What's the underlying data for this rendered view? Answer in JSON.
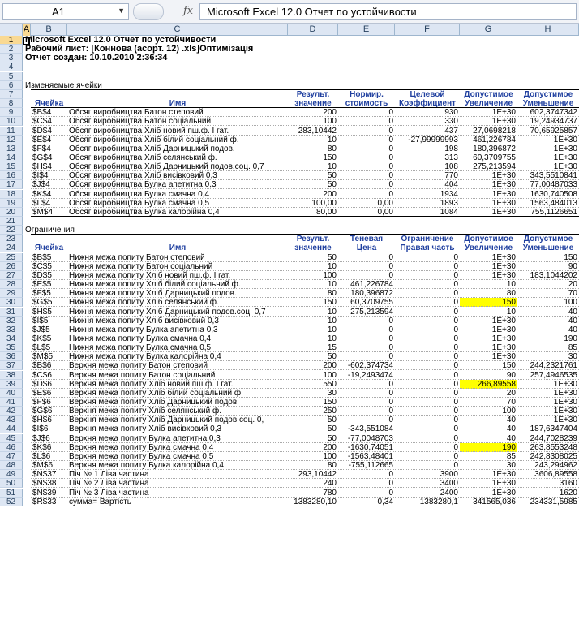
{
  "formula_bar": {
    "cell_ref": "A1",
    "fx": "fx",
    "formula": "Microsoft Excel 12.0 Отчет по устойчивости"
  },
  "columns": [
    "A",
    "B",
    "C",
    "D",
    "E",
    "F",
    "G",
    "H"
  ],
  "title_rows": {
    "r1": "Microsoft Excel 12.0 Отчет по устойчивости",
    "r2": "Рабочий лист: [Коннова (асорт. 12) .xls]Оптимізація",
    "r3": "Отчет создан: 10.10.2010 2:36:34"
  },
  "section1": {
    "title": "Изменяемые ячейки",
    "headers": {
      "cell": "Ячейка",
      "name": "Имя",
      "result": [
        "Результ.",
        "значение"
      ],
      "norm": [
        "Нормир.",
        "стоимость"
      ],
      "target": [
        "Целевой",
        "Коэффициент"
      ],
      "inc": [
        "Допустимое",
        "Увеличение"
      ],
      "dec": [
        "Допустимое",
        "Уменьшение"
      ]
    },
    "rows": [
      {
        "n": "9",
        "cell": "$B$4",
        "name": "Обсяг виробництва  Батон степовий",
        "d": "200",
        "e": "0",
        "f": "930",
        "g": "1E+30",
        "h": "602,3747342"
      },
      {
        "n": "10",
        "cell": "$C$4",
        "name": "Обсяг виробництва Батон соціальний",
        "d": "100",
        "e": "0",
        "f": "330",
        "g": "1E+30",
        "h": "19,24934737"
      },
      {
        "n": "11",
        "cell": "$D$4",
        "name": "Обсяг виробництва Хліб новий пш.ф. І гат.",
        "d": "283,10442",
        "e": "0",
        "f": "437",
        "g": "27,0698218",
        "h": "70,65925857"
      },
      {
        "n": "12",
        "cell": "$E$4",
        "name": "Обсяг виробництва Хліб білий соціальний ф.",
        "d": "10",
        "e": "0",
        "f": "-27,99999993",
        "g": "461,226784",
        "h": "1E+30"
      },
      {
        "n": "13",
        "cell": "$F$4",
        "name": "Обсяг виробництва Хліб Дарницький подов.",
        "d": "80",
        "e": "0",
        "f": "198",
        "g": "180,396872",
        "h": "1E+30"
      },
      {
        "n": "14",
        "cell": "$G$4",
        "name": "Обсяг виробництва Хліб селянський ф.",
        "d": "150",
        "e": "0",
        "f": "313",
        "g": "60,3709755",
        "h": "1E+30"
      },
      {
        "n": "15",
        "cell": "$H$4",
        "name": "Обсяг виробництва Хліб Дарницький подов.соц. 0,7",
        "d": "10",
        "e": "0",
        "f": "108",
        "g": "275,213594",
        "h": "1E+30"
      },
      {
        "n": "16",
        "cell": "$I$4",
        "name": "Обсяг виробництва Хліб висівковий 0,3",
        "d": "50",
        "e": "0",
        "f": "770",
        "g": "1E+30",
        "h": "343,5510841"
      },
      {
        "n": "17",
        "cell": "$J$4",
        "name": "Обсяг виробництва Булка апетитна 0,3",
        "d": "50",
        "e": "0",
        "f": "404",
        "g": "1E+30",
        "h": "77,00487033"
      },
      {
        "n": "18",
        "cell": "$K$4",
        "name": "Обсяг виробництва Булка смачна 0,4",
        "d": "200",
        "e": "0",
        "f": "1934",
        "g": "1E+30",
        "h": "1630,740508"
      },
      {
        "n": "19",
        "cell": "$L$4",
        "name": "Обсяг виробництва Булка смачна 0,5",
        "d": "100,00",
        "e": "0,00",
        "f": "1893",
        "g": "1E+30",
        "h": "1563,484013"
      },
      {
        "n": "20",
        "cell": "$M$4",
        "name": "Обсяг виробництва Булка калорійна 0,4",
        "d": "80,00",
        "e": "0,00",
        "f": "1084",
        "g": "1E+30",
        "h": "755,1126651"
      }
    ]
  },
  "section2": {
    "title": "Ограничения",
    "headers": {
      "cell": "Ячейка",
      "name": "Имя",
      "result": [
        "Результ.",
        "значение"
      ],
      "shadow": [
        "Теневая",
        "Цена"
      ],
      "rhs": [
        "Ограничение",
        "Правая часть"
      ],
      "inc": [
        "Допустимое",
        "Увеличение"
      ],
      "dec": [
        "Допустимое",
        "Уменьшение"
      ]
    },
    "rows": [
      {
        "n": "25",
        "cell": "$B$5",
        "name": "Нижня межа попиту  Батон степовий",
        "d": "50",
        "e": "0",
        "f": "0",
        "g": "1E+30",
        "h": "150"
      },
      {
        "n": "26",
        "cell": "$C$5",
        "name": "Нижня межа попиту Батон соціальний",
        "d": "10",
        "e": "0",
        "f": "0",
        "g": "1E+30",
        "h": "90"
      },
      {
        "n": "27",
        "cell": "$D$5",
        "name": "Нижня межа попиту Хліб новий пш.ф. І гат.",
        "d": "100",
        "e": "0",
        "f": "0",
        "g": "1E+30",
        "h": "183,1044202"
      },
      {
        "n": "28",
        "cell": "$E$5",
        "name": "Нижня межа попиту Хліб білий соціальний ф.",
        "d": "10",
        "e": "461,226784",
        "f": "0",
        "g": "10",
        "h": "20"
      },
      {
        "n": "29",
        "cell": "$F$5",
        "name": "Нижня межа попиту Хліб Дарницький подов.",
        "d": "80",
        "e": "180,396872",
        "f": "0",
        "g": "80",
        "h": "70"
      },
      {
        "n": "30",
        "cell": "$G$5",
        "name": "Нижня межа попиту Хліб селянський ф.",
        "d": "150",
        "e": "60,3709755",
        "f": "0",
        "g": "150",
        "h": "100",
        "hl": true
      },
      {
        "n": "31",
        "cell": "$H$5",
        "name": "Нижня межа попиту Хліб Дарницький подов.соц. 0,7",
        "d": "10",
        "e": "275,213594",
        "f": "0",
        "g": "10",
        "h": "40"
      },
      {
        "n": "32",
        "cell": "$I$5",
        "name": "Нижня межа попиту Хліб висівковий 0,3",
        "d": "10",
        "e": "0",
        "f": "0",
        "g": "1E+30",
        "h": "40"
      },
      {
        "n": "33",
        "cell": "$J$5",
        "name": "Нижня межа попиту Булка апетитна 0,3",
        "d": "10",
        "e": "0",
        "f": "0",
        "g": "1E+30",
        "h": "40"
      },
      {
        "n": "34",
        "cell": "$K$5",
        "name": "Нижня межа попиту Булка смачна 0,4",
        "d": "10",
        "e": "0",
        "f": "0",
        "g": "1E+30",
        "h": "190"
      },
      {
        "n": "35",
        "cell": "$L$5",
        "name": "Нижня межа попиту Булка смачна 0,5",
        "d": "15",
        "e": "0",
        "f": "0",
        "g": "1E+30",
        "h": "85"
      },
      {
        "n": "36",
        "cell": "$M$5",
        "name": "Нижня межа попиту Булка калорійна 0,4",
        "d": "50",
        "e": "0",
        "f": "0",
        "g": "1E+30",
        "h": "30"
      },
      {
        "n": "37",
        "cell": "$B$6",
        "name": "Верхня межа попиту  Батон степовий",
        "d": "200",
        "e": "-602,374734",
        "f": "0",
        "g": "150",
        "h": "244,2321761"
      },
      {
        "n": "38",
        "cell": "$C$6",
        "name": "Верхня межа попиту Батон соціальний",
        "d": "100",
        "e": "-19,2493474",
        "f": "0",
        "g": "90",
        "h": "257,4946535"
      },
      {
        "n": "39",
        "cell": "$D$6",
        "name": "Верхня межа попиту Хліб новий пш.ф. І гат.",
        "d": "550",
        "e": "0",
        "f": "0",
        "g": "266,89558",
        "h": "1E+30",
        "hl": true
      },
      {
        "n": "40",
        "cell": "$E$6",
        "name": "Верхня межа попиту Хліб білий соціальний ф.",
        "d": "30",
        "e": "0",
        "f": "0",
        "g": "20",
        "h": "1E+30"
      },
      {
        "n": "41",
        "cell": "$F$6",
        "name": "Верхня межа попиту Хліб Дарницький подов.",
        "d": "150",
        "e": "0",
        "f": "0",
        "g": "70",
        "h": "1E+30"
      },
      {
        "n": "42",
        "cell": "$G$6",
        "name": "Верхня межа попиту Хліб селянський ф.",
        "d": "250",
        "e": "0",
        "f": "0",
        "g": "100",
        "h": "1E+30"
      },
      {
        "n": "43",
        "cell": "$H$6",
        "name": "Верхня межа попиту Хліб Дарницький подов.соц. 0,",
        "d": "50",
        "e": "0",
        "f": "0",
        "g": "40",
        "h": "1E+30"
      },
      {
        "n": "44",
        "cell": "$I$6",
        "name": "Верхня межа попиту Хліб висівковий 0,3",
        "d": "50",
        "e": "-343,551084",
        "f": "0",
        "g": "40",
        "h": "187,6347404"
      },
      {
        "n": "45",
        "cell": "$J$6",
        "name": "Верхня межа попиту Булка апетитна 0,3",
        "d": "50",
        "e": "-77,0048703",
        "f": "0",
        "g": "40",
        "h": "244,7028239"
      },
      {
        "n": "46",
        "cell": "$K$6",
        "name": "Верхня межа попиту Булка смачна 0,4",
        "d": "200",
        "e": "-1630,74051",
        "f": "0",
        "g": "190",
        "h": "263,8553248",
        "hl": true
      },
      {
        "n": "47",
        "cell": "$L$6",
        "name": "Верхня межа попиту Булка смачна 0,5",
        "d": "100",
        "e": "-1563,48401",
        "f": "0",
        "g": "85",
        "h": "242,8308025"
      },
      {
        "n": "48",
        "cell": "$M$6",
        "name": "Верхня межа попиту Булка калорійна 0,4",
        "d": "80",
        "e": "-755,112665",
        "f": "0",
        "g": "30",
        "h": "243,294962"
      },
      {
        "n": "49",
        "cell": "$N$37",
        "name": "Піч № 1 Ліва частина",
        "d": "293,10442",
        "e": "0",
        "f": "3900",
        "g": "1E+30",
        "h": "3606,89558"
      },
      {
        "n": "50",
        "cell": "$N$38",
        "name": "Піч № 2 Ліва частина",
        "d": "240",
        "e": "0",
        "f": "3400",
        "g": "1E+30",
        "h": "3160"
      },
      {
        "n": "51",
        "cell": "$N$39",
        "name": "Піч № 3 Ліва частина",
        "d": "780",
        "e": "0",
        "f": "2400",
        "g": "1E+30",
        "h": "1620"
      },
      {
        "n": "52",
        "cell": "$R$33",
        "name": "сумма= Вартість",
        "d": "1383280,10",
        "e": "0,34",
        "f": "1383280,1",
        "g": "341565,036",
        "h": "234331,5985"
      }
    ]
  }
}
